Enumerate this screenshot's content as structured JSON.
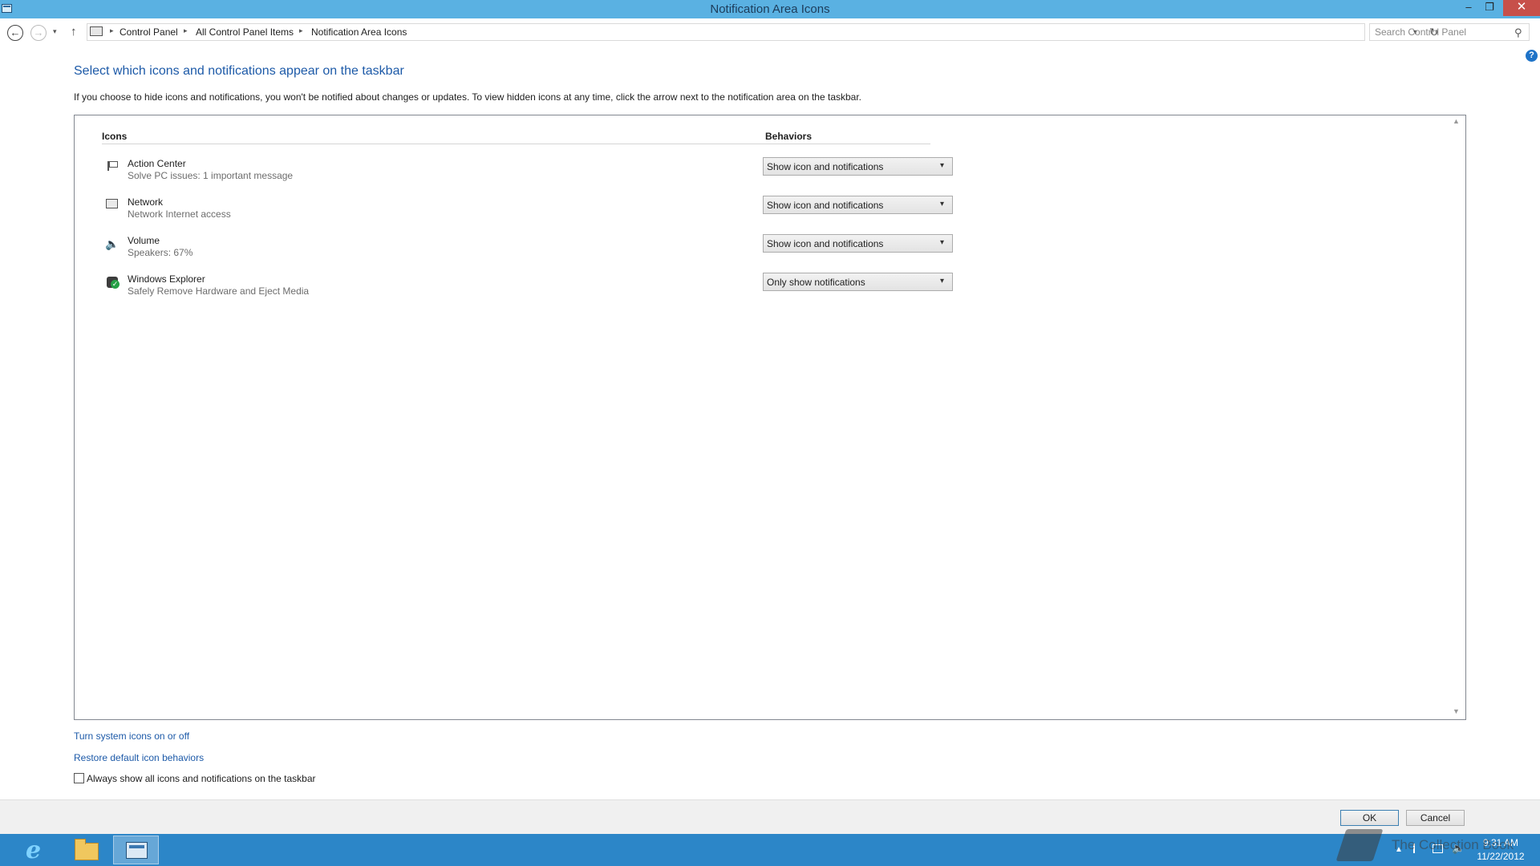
{
  "window": {
    "title": "Notification Area Icons",
    "minimize": "–",
    "maximize": "❐",
    "close": "✕"
  },
  "nav": {
    "back": "←",
    "forward": "→",
    "recent": "▾",
    "up": "↑",
    "breadcrumb": [
      "Control Panel",
      "All Control Panel Items",
      "Notification Area Icons"
    ],
    "separator": "▸",
    "dropdown": "▾",
    "refresh": "↻",
    "search_placeholder": "Search Control Panel",
    "search_glyph": "⚲"
  },
  "help": "?",
  "heading": "Select which icons and notifications appear on the taskbar",
  "intro": "If you choose to hide icons and notifications, you won't be notified about changes or updates. To view hidden icons at any time, click the arrow next to the notification area on the taskbar.",
  "table": {
    "col_icons": "Icons",
    "col_behaviors": "Behaviors",
    "scroll_up": "▲",
    "scroll_down": "▼",
    "rows": [
      {
        "name": "Action Center",
        "desc": "Solve PC issues: 1 important message",
        "behavior": "Show icon and notifications",
        "icon": "flag-icon"
      },
      {
        "name": "Network",
        "desc": "Network Internet access",
        "behavior": "Show icon and notifications",
        "icon": "network-icon"
      },
      {
        "name": "Volume",
        "desc": "Speakers: 67%",
        "behavior": "Show icon and notifications",
        "icon": "speaker-icon"
      },
      {
        "name": "Windows Explorer",
        "desc": "Safely Remove Hardware and Eject Media",
        "behavior": "Only show notifications",
        "icon": "usb-eject-icon"
      }
    ],
    "dropdown_arrow": "▾",
    "volume_glyph": "🔈"
  },
  "links": {
    "system_icons": "Turn system icons on or off",
    "restore": "Restore default icon behaviors"
  },
  "always_show": {
    "label": "Always show all icons and notifications on the taskbar",
    "checked": false
  },
  "buttons": {
    "ok": "OK",
    "cancel": "Cancel"
  },
  "taskbar": {
    "ie_glyph": "e",
    "tray_up": "▲",
    "tray_volume": "🔈",
    "time": "9:31 AM",
    "date": "11/22/2012"
  },
  "watermark": "The Collection Book",
  "colors": {
    "titlebar": "#5ab1e2",
    "taskbar": "#2c86c8",
    "link": "#1d5aa8",
    "close": "#c7504a"
  }
}
